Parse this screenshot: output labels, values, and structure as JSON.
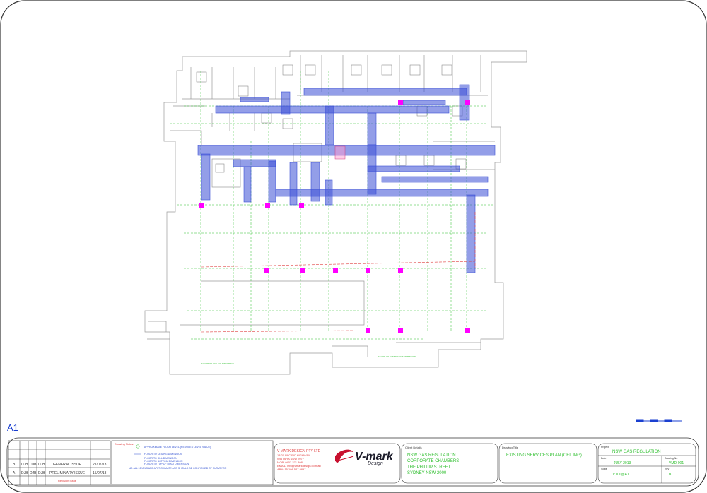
{
  "sheet": {
    "size_label": "A1"
  },
  "notes": {
    "heading": "Drawing Notes:",
    "items": [
      "APPROXIMATE FLOOR LEVEL (REDUCED LEVEL VALUE)",
      "FLOOR TO CEILING DIMENSION",
      "FLOOR TO SILL DIMENSION",
      "FLOOR TO BOTTOM DIMENSION",
      "FLOOR TO TOP OF DUCT DIMENSION",
      "NB: ALL LEVELS ARE APPROXIMATE AND SHOULD BE CONFIRMED BY SURVEYOR"
    ]
  },
  "revisions": {
    "rows": [
      {
        "rev": "B",
        "by": "DJB",
        "chk": "DJB",
        "app": "DJB",
        "desc": "GENERAL ISSUE",
        "date": "21/07/13"
      },
      {
        "rev": "A",
        "by": "DJB",
        "chk": "DJB",
        "app": "DJB",
        "desc": "PRELIMINARY ISSUE",
        "date": "15/07/13"
      }
    ],
    "footer": "Revision Issue"
  },
  "company": {
    "name": "V-MARK DESIGN PTY LTD",
    "address_1": "18/20 PACIFIC HIGHWAY",
    "address_2": "WAITARA NSW 2077",
    "phone": "MOB: 0403 271 408",
    "email": "EMAIL: info@vmarkdesign.com.au",
    "abn": "ABN: 15 108 547 9897",
    "logo_main": "V-mark",
    "logo_sub": "Design"
  },
  "client": {
    "heading": "Client Details",
    "lines": [
      "NSW GAS REGULATION",
      "CORPORATE CHAMBERS",
      "THE PHILLIP STREET",
      "SYDNEY NSW 2000"
    ]
  },
  "drawing_title": {
    "heading": "Drawing Title",
    "value": "EXISTING SERVICES PLAN (CEILING)"
  },
  "project": {
    "project_label": "Project",
    "project_value": "NSW GAS REGULATION",
    "date_label": "Date",
    "date_value": "JULY 2013",
    "drawing_no_label": "Drawing No",
    "drawing_no_value": "VMD-001",
    "scale_label": "Scale",
    "scale_value": "1:100@A1",
    "rev_label": "Rev",
    "rev_value": "B"
  },
  "plan": {
    "labels": [
      "FLOOR TO CEILING DIMENSION",
      "FLOOR TO COMPONENT DIMENSION"
    ]
  },
  "colors": {
    "duct": "#3a4fd6",
    "grid": "#2fbf2f",
    "column": "#ff00ff",
    "pipe": "#e04040"
  }
}
